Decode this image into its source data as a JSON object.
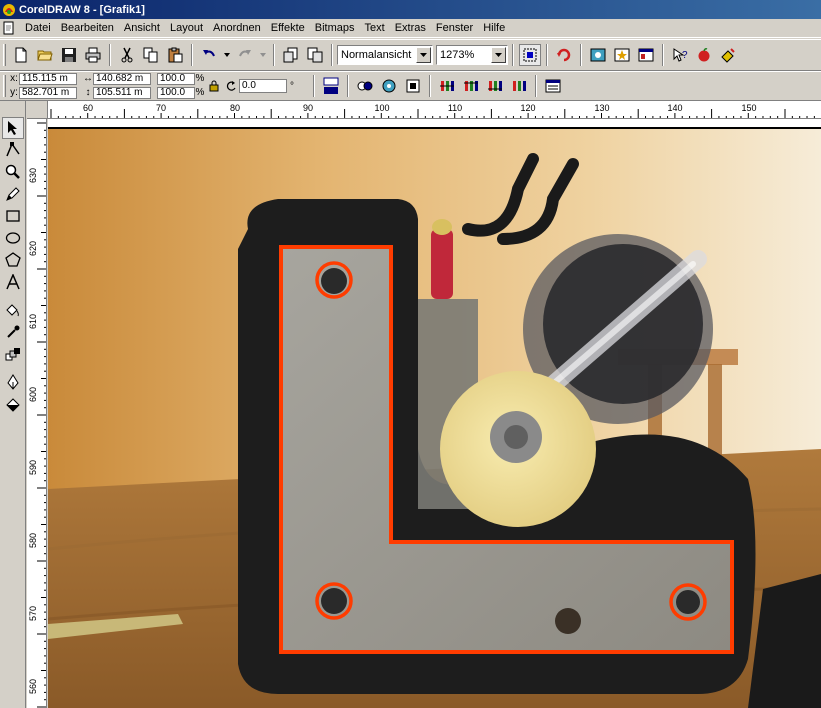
{
  "window": {
    "title": "CorelDRAW 8 - [Grafik1]"
  },
  "menu": {
    "items": [
      "Datei",
      "Bearbeiten",
      "Ansicht",
      "Layout",
      "Anordnen",
      "Effekte",
      "Bitmaps",
      "Text",
      "Extras",
      "Fenster",
      "Hilfe"
    ]
  },
  "toolbar": {
    "view_mode": "Normalansicht",
    "zoom": "1273%"
  },
  "property_bar": {
    "x_label": "x:",
    "x": "115.115 m",
    "y_label": "y:",
    "y": "582.701 m",
    "width": "140.682 m",
    "height": "105.511 m",
    "scale_x": "100.0",
    "scale_y": "100.0",
    "percent": "%",
    "rotation": "0.0",
    "degree": "°"
  },
  "rulers": {
    "h_labels": [
      "60",
      "70",
      "80",
      "90",
      "100",
      "110",
      "120",
      "130",
      "140",
      "150"
    ],
    "v_labels": [
      "630",
      "620",
      "610",
      "600",
      "590",
      "580",
      "570",
      "560"
    ]
  },
  "colors": {
    "titlebar_start": "#0a246a",
    "titlebar_end": "#3a6ea5",
    "ui_gray": "#d4d0c8",
    "outline_orange": "#ff3c00"
  }
}
